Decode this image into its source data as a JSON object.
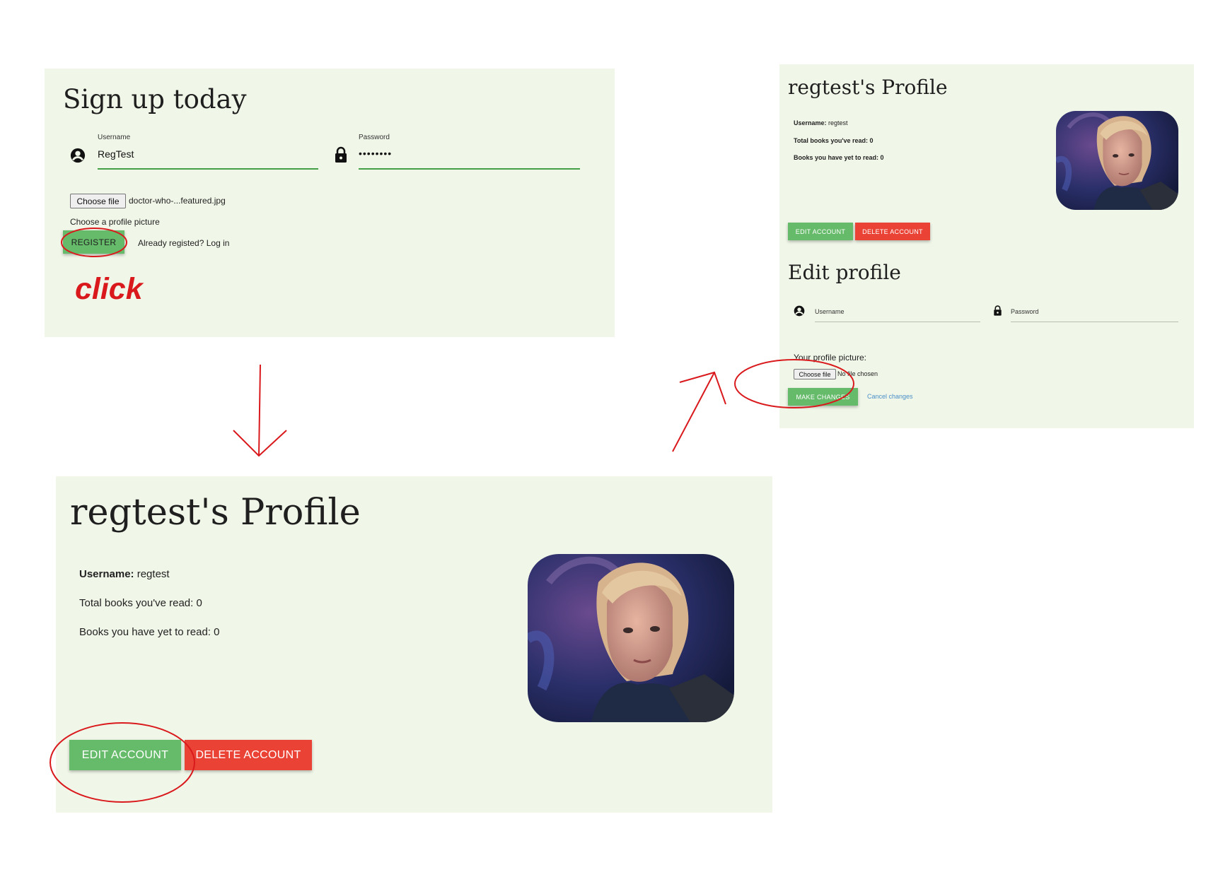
{
  "signup": {
    "title": "Sign up today",
    "username_label": "Username",
    "username_value": "RegTest",
    "password_label": "Password",
    "password_value": "••••••••",
    "file_button": "Choose file",
    "file_name": "doctor-who-...featured.jpg",
    "file_hint": "Choose a profile picture",
    "register_button": "REGISTER",
    "login_link": "Already registed? Log in",
    "annotation": "click"
  },
  "profile_large": {
    "title": "regtest's Profile",
    "username_label": "Username:",
    "username_value": "regtest",
    "books_read": "Total books you've read: 0",
    "books_to_read": "Books you have yet to read: 0",
    "edit_button": "EDIT ACCOUNT",
    "delete_button": "DELETE ACCOUNT"
  },
  "profile_small": {
    "title": "regtest's Profile",
    "username_label": "Username:",
    "username_value": "regtest",
    "books_read": "Total books you've read: 0",
    "books_to_read": "Books you have yet to read: 0",
    "edit_button": "EDIT ACCOUNT",
    "delete_button": "DELETE ACCOUNT",
    "edit_title": "Edit profile",
    "username_placeholder": "Username",
    "password_placeholder": "Password",
    "picture_label": "Your profile picture:",
    "file_button": "Choose file",
    "file_status": "No file chosen",
    "make_changes_button": "MAKE CHANGES",
    "cancel_link": "Cancel changes"
  },
  "icons": {
    "user": "account-circle-icon",
    "lock": "lock-icon"
  },
  "colors": {
    "panel_bg": "#f0f6e8",
    "green": "#66bb6a",
    "red": "#ea4335",
    "annotation_red": "#d9191c",
    "field_underline": "#43a047",
    "link_blue": "#4a90c8"
  }
}
